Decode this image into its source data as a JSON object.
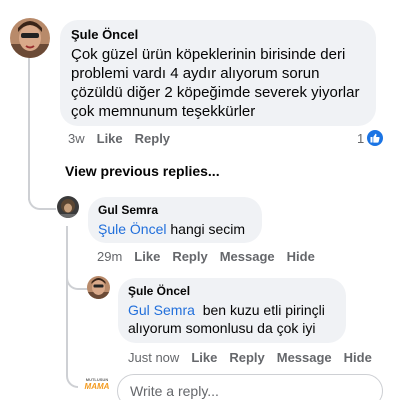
{
  "comment1": {
    "author": "Şule Öncel",
    "text": "Çok güzel ürün köpeklerinin birisinde deri problemi vardı 4 aydır alıyorum sorun çözüldü diğer 2 köpeğimde severek yiyorlar çok memnunum teşekkürler",
    "time": "3w",
    "like_label": "Like",
    "reply_label": "Reply",
    "reaction_count": "1"
  },
  "view_previous_label": "View previous replies...",
  "reply1": {
    "author": "Gul Semra",
    "mention": "Şule Öncel",
    "text": "hangi secim",
    "time": "29m",
    "like_label": "Like",
    "reply_label": "Reply",
    "message_label": "Message",
    "hide_label": "Hide"
  },
  "reply2": {
    "author": "Şule Öncel",
    "mention": "Gul Semra",
    "text_line1": "ben kuzu etli pirinçli",
    "text_line2": "alıyorum somonlusu da çok iyi",
    "time": "Just now",
    "like_label": "Like",
    "reply_label": "Reply",
    "message_label": "Message",
    "hide_label": "Hide"
  },
  "composer": {
    "placeholder": "Write a reply...",
    "logo_top": "MUTLUSUN",
    "logo_bottom": "MAMA"
  },
  "colors": {
    "bubble": "#f0f2f5",
    "mention": "#216fdb",
    "like_badge": "#1b74e4",
    "thread_line": "#ced0d4"
  },
  "icons": [
    "like-thumb-icon"
  ]
}
